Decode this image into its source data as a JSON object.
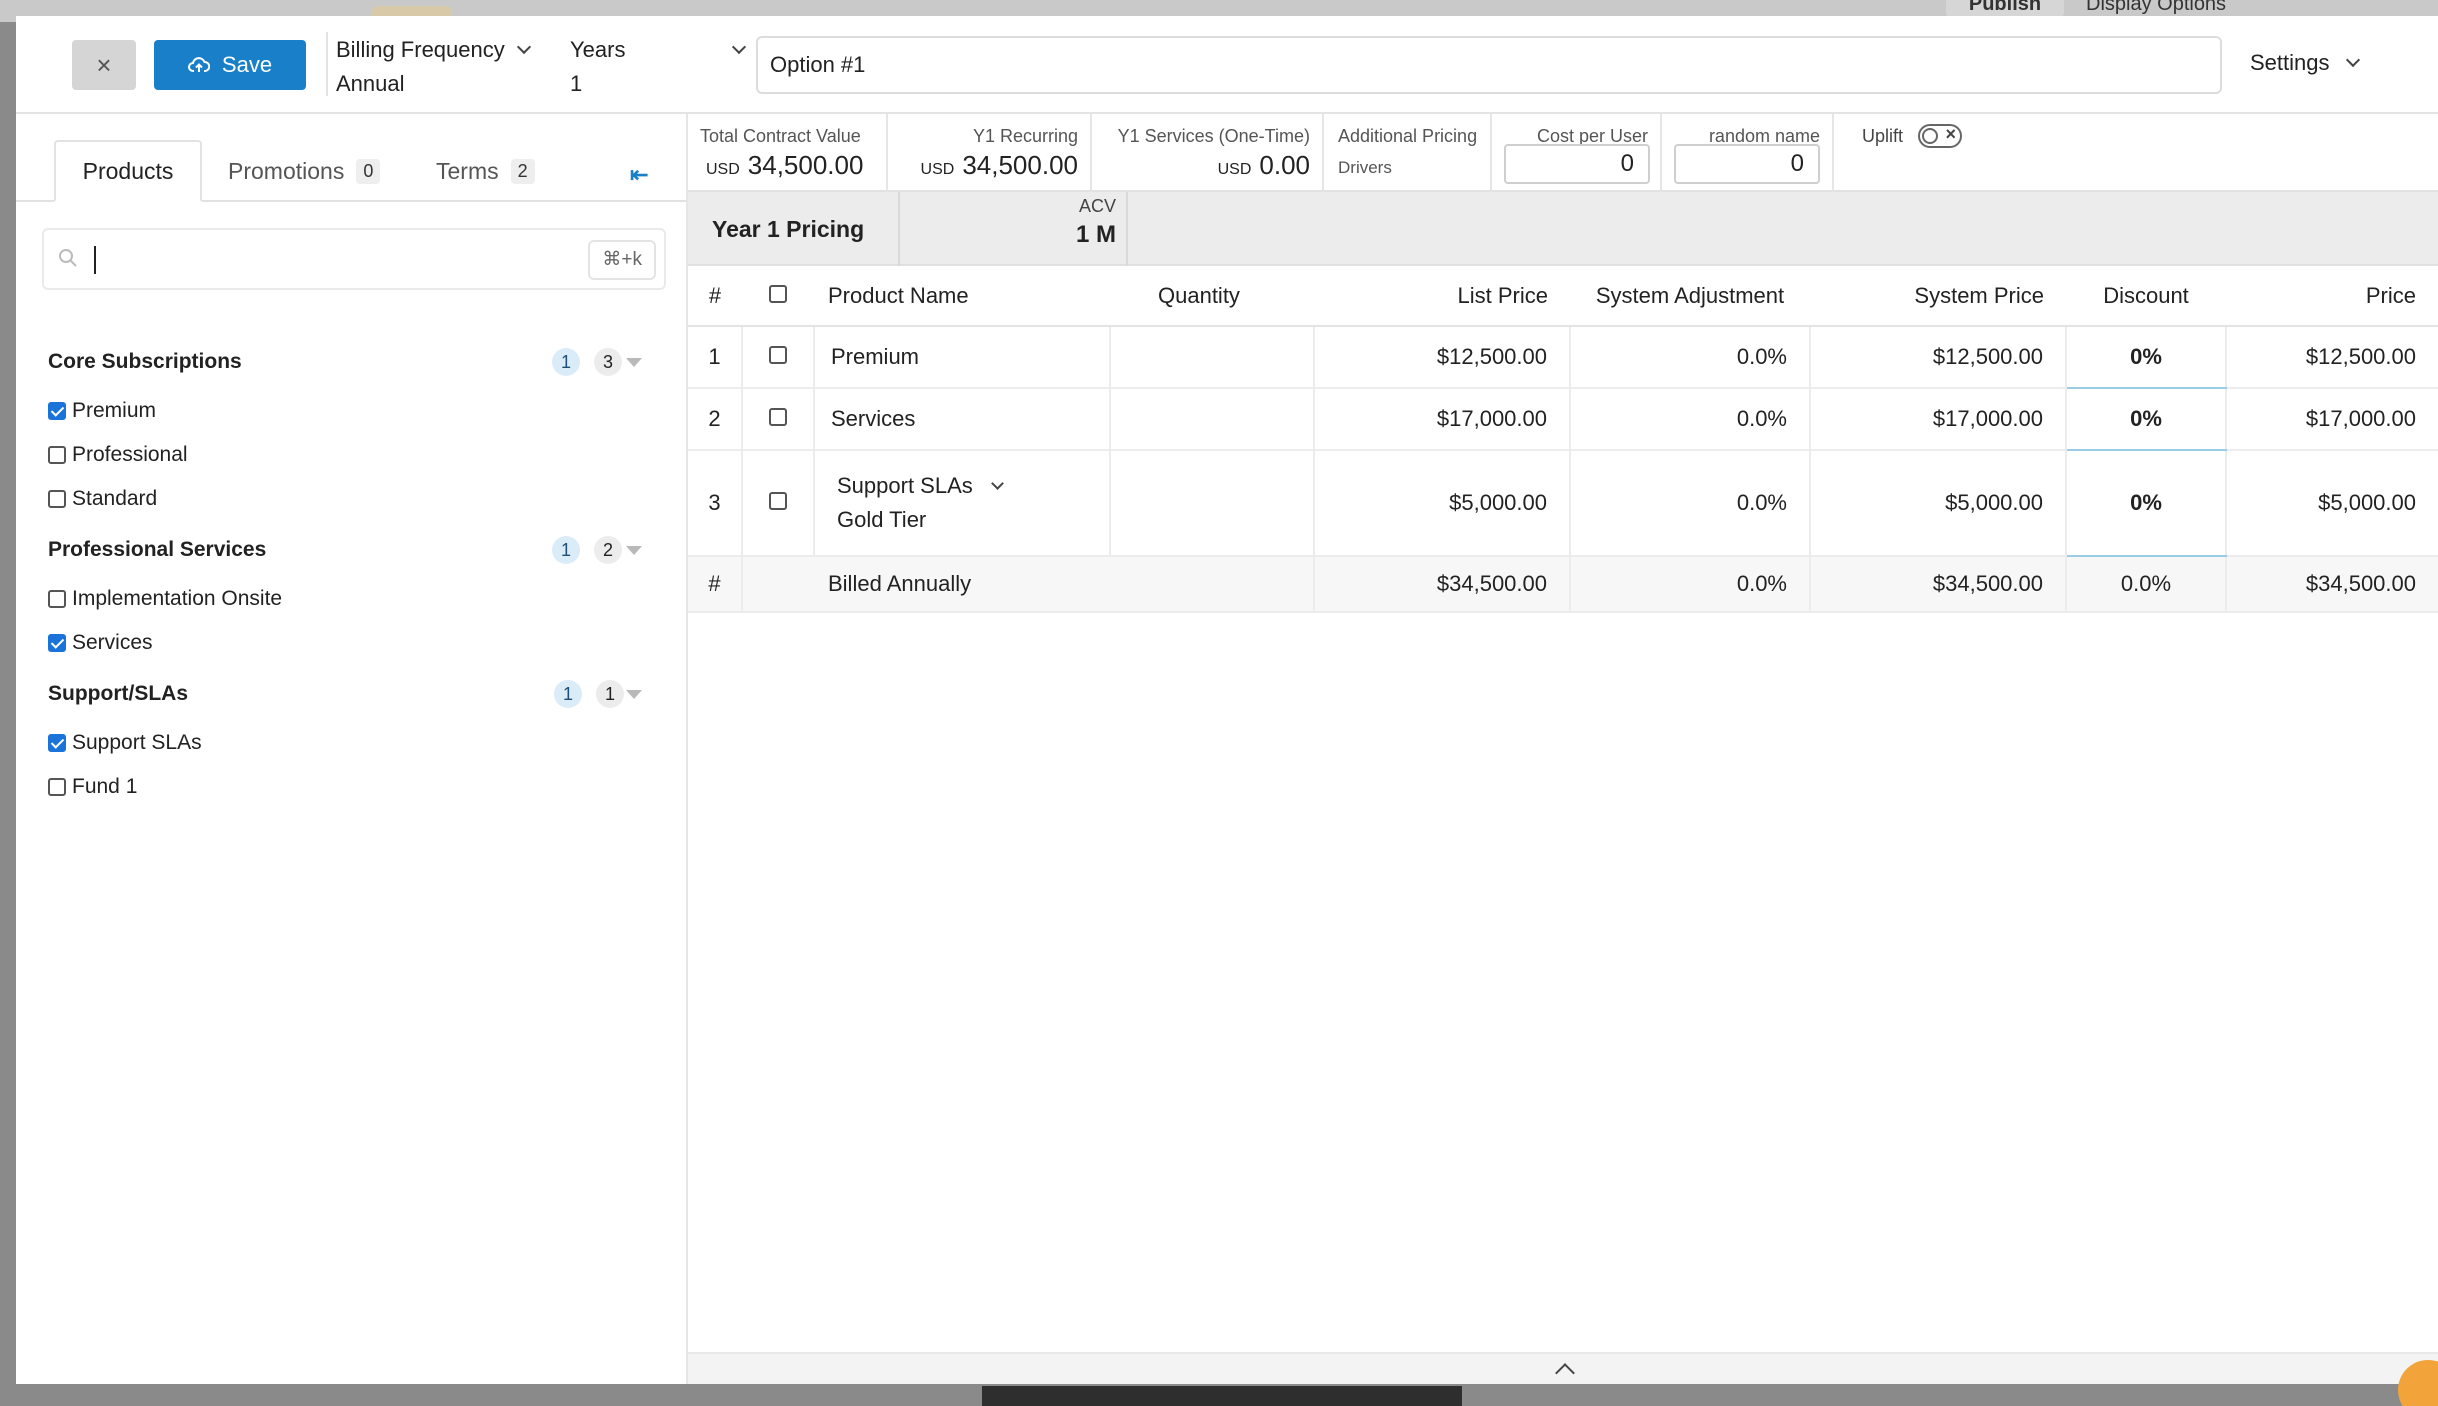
{
  "header": {
    "close_label": "×",
    "save_label": "Save",
    "billing_frequency_label": "Billing Frequency",
    "billing_frequency_value": "Annual",
    "years_label": "Years",
    "years_value": "1",
    "option_name": "Option #1",
    "settings_label": "Settings"
  },
  "background": {
    "publish_label": "Publish",
    "display_options_label": "Display Options"
  },
  "tabs": [
    {
      "label": "Products",
      "count": ""
    },
    {
      "label": "Promotions",
      "count": "0"
    },
    {
      "label": "Terms",
      "count": "2"
    }
  ],
  "search": {
    "shortcut": "⌘+k",
    "value": ""
  },
  "groups": [
    {
      "name": "Core Subscriptions",
      "selected": "1",
      "total": "3",
      "items": [
        {
          "label": "Premium",
          "checked": true
        },
        {
          "label": "Professional",
          "checked": false
        },
        {
          "label": "Standard",
          "checked": false
        }
      ]
    },
    {
      "name": "Professional Services",
      "selected": "1",
      "total": "2",
      "items": [
        {
          "label": "Implementation Onsite",
          "checked": false
        },
        {
          "label": "Services",
          "checked": true
        }
      ]
    },
    {
      "name": "Support/SLAs",
      "selected": "1",
      "total": "1",
      "items": [
        {
          "label": "Support SLAs",
          "checked": true
        },
        {
          "label": "Fund 1",
          "checked": false
        }
      ]
    }
  ],
  "metrics": {
    "tcv_label": "Total Contract Value",
    "tcv_currency": "USD",
    "tcv_value": "34,500.00",
    "y1r_label": "Y1 Recurring",
    "y1r_currency": "USD",
    "y1r_value": "34,500.00",
    "y1s_label": "Y1 Services (One-Time)",
    "y1s_currency": "USD",
    "y1s_value": "0.00",
    "apd_label": "Additional Pricing",
    "apd_label2": "Drivers",
    "cpu_label": "Cost per User",
    "cpu_value": "0",
    "rn_label": "random name",
    "rn_value": "0",
    "uplift_label": "Uplift"
  },
  "pricing": {
    "title": "Year 1 Pricing",
    "acv_label": "ACV",
    "acv_value": "1 M"
  },
  "table": {
    "headers": {
      "num": "#",
      "product": "Product Name",
      "quantity": "Quantity",
      "list": "List Price",
      "sysadj": "System Adjustment",
      "sysprice": "System Price",
      "discount": "Discount",
      "price": "Price"
    },
    "rows": [
      {
        "num": "1",
        "product": "Premium",
        "tier": "",
        "quantity": "",
        "list": "$12,500.00",
        "sysadj": "0.0%",
        "sysprice": "$12,500.00",
        "discount": "0%",
        "price": "$12,500.00"
      },
      {
        "num": "2",
        "product": "Services",
        "tier": "",
        "quantity": "",
        "list": "$17,000.00",
        "sysadj": "0.0%",
        "sysprice": "$17,000.00",
        "discount": "0%",
        "price": "$17,000.00"
      },
      {
        "num": "3",
        "product": "Support SLAs",
        "tier": "Gold Tier",
        "quantity": "",
        "list": "$5,000.00",
        "sysadj": "0.0%",
        "sysprice": "$5,000.00",
        "discount": "0%",
        "price": "$5,000.00"
      }
    ],
    "total": {
      "num": "#",
      "label": "Billed Annually",
      "list": "$34,500.00",
      "sysadj": "0.0%",
      "sysprice": "$34,500.00",
      "discount": "0.0%",
      "price": "$34,500.00"
    }
  },
  "colors": {
    "accent": "#1a7fc9",
    "checkbox": "#1a73d9"
  }
}
